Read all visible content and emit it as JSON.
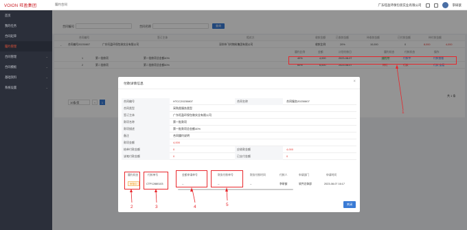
{
  "header": {
    "logo": "VOION",
    "logo_sub": "旺盈集团",
    "breadcrumb": "履约合同",
    "company": "广东旺盈环保包装实业有限公司",
    "user": "李研歆"
  },
  "sidebar": {
    "items": [
      {
        "label": "首页"
      },
      {
        "label": "我的任务"
      },
      {
        "label": "合同起草"
      },
      {
        "label": "履约管理"
      },
      {
        "label": "合同管理"
      },
      {
        "label": "合同模板"
      },
      {
        "label": "基础资料"
      },
      {
        "label": "系统设置"
      }
    ]
  },
  "filter": {
    "contract_no_label": "合同编号",
    "contract_name_label": "合同名称",
    "search_label": "查询"
  },
  "table": {
    "headers": [
      "合同编号",
      "签订主体",
      "相对方",
      "收款金额",
      "已收款金额",
      "待收款金额",
      "已付款金额",
      "待付款金额"
    ],
    "main_row": {
      "no": "合同编号20230807",
      "party": "广东旺盈环保包装实业有限公司",
      "counterparty": "深圳市飞时物料集团有限公司",
      "amount1": "收款比例",
      "amount2": "20%",
      "amount3": "10,000",
      "amount4": "0",
      "amount5": "8,000",
      "amount6": "4,000"
    },
    "sub_headers": [
      "履约比例",
      "金额",
      "计划付款日",
      "履约状态",
      "付款状态",
      "操作"
    ],
    "sub_rows": [
      {
        "idx": "1",
        "name": "第一批款项",
        "desc": "第一批款项总金额40%",
        "ratio": "40%",
        "amount": "4,000",
        "date": "2023-08-07",
        "status": "履约中",
        "pay": "付款中",
        "op": "付款查看"
      },
      {
        "idx": "2",
        "name": "第二批款项",
        "desc": "第二批款项总金额60%",
        "ratio": "60%",
        "amount": "6,000",
        "date": "2023-08-07",
        "status": "待付",
        "pay": "付款",
        "op": "付款 查看"
      }
    ]
  },
  "pager": {
    "page_size": "10条/页",
    "current": "1",
    "total": "共 1 条"
  },
  "modal": {
    "title": "付款详情信息",
    "close": "×",
    "fields": [
      {
        "l1": "合同编号",
        "v1": "HTCC20230807",
        "l2": "合同名称",
        "v2": "合同服务20230807"
      },
      {
        "l1": "合同类型",
        "v1": "采购类服务类型"
      },
      {
        "l1": "签订主体",
        "v1": "广东旺盈环保包装实业有限公司"
      },
      {
        "l1": "款项名称",
        "v1": "第一批款项"
      },
      {
        "l1": "款项描述",
        "v1": "第一批款项总金额40%"
      },
      {
        "l1": "备注",
        "v1": "合同履约说明"
      },
      {
        "l1": "款项金额",
        "v1": "4,000"
      },
      {
        "l1": "结单付款金额",
        "v1": "0",
        "l2": "应收款金额",
        "v2": "4,000"
      },
      {
        "l1": "该笔付款金额",
        "v1": "0",
        "l2": "已支付金额",
        "v2": "0"
      }
    ],
    "inner_headers": [
      "履约状态",
      "付款单号",
      "金额申请单号",
      "财务付款单号",
      "财务付款时间",
      "付款人",
      "申请部门",
      "申请时间"
    ],
    "inner_row": {
      "status": "审核中",
      "pay_no": "CTP12880103",
      "apply_no": "--",
      "finance_no": "--",
      "finance_time": "--",
      "payer": "李研歆",
      "dept": "软件总体部",
      "time": "2023-08-07 16:17"
    },
    "close_button": "关闭"
  },
  "annotations": [
    "1",
    "2",
    "3",
    "4",
    "5"
  ],
  "colors": {
    "accent": "#3a7bd5",
    "alert": "#e8252a",
    "brand": "#c8161d"
  }
}
